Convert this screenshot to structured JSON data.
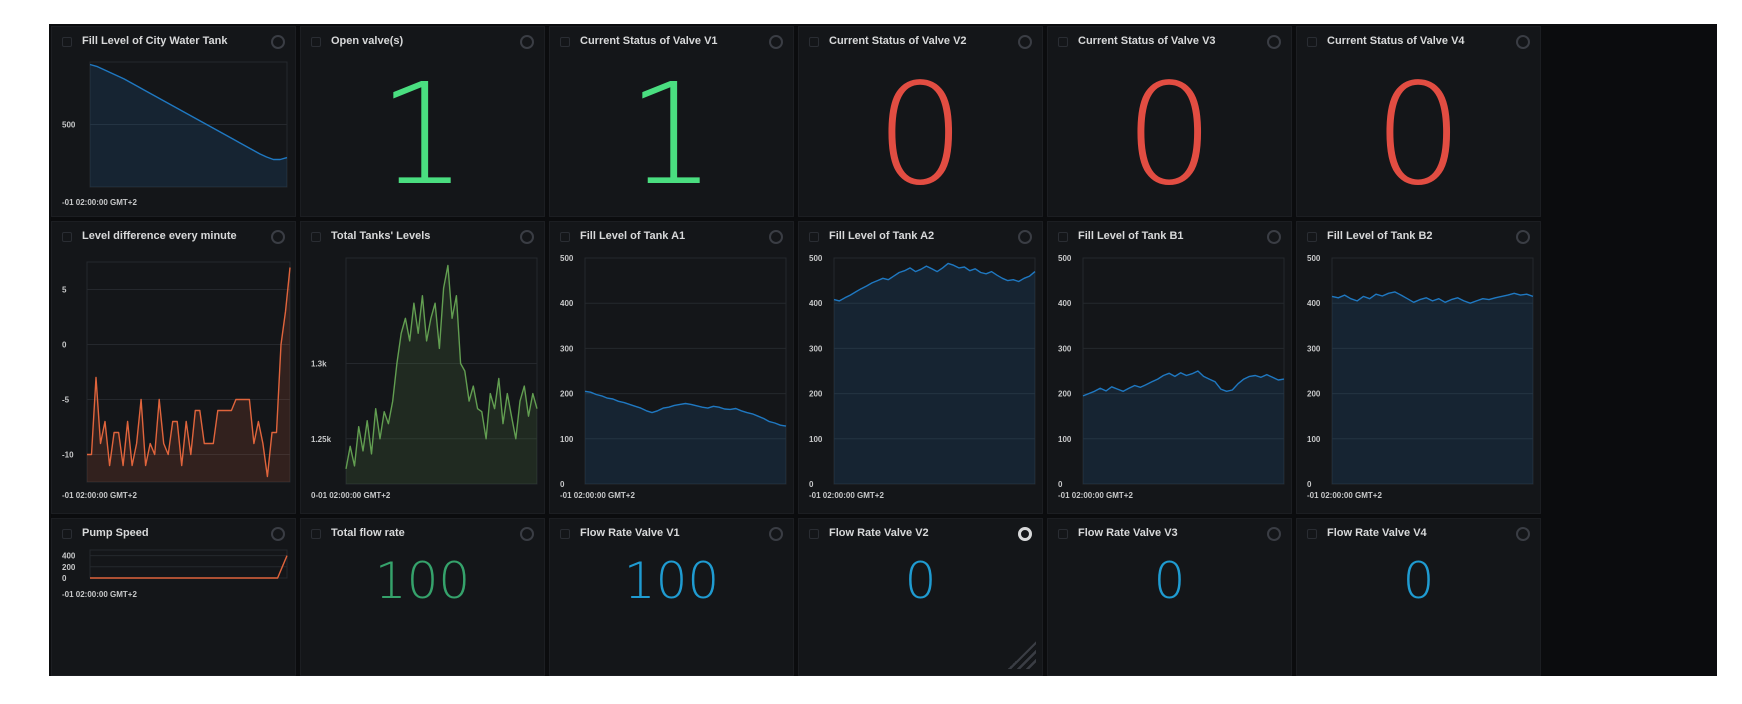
{
  "panels": {
    "city_tank": {
      "title": "Fill Level of City Water Tank",
      "y_tick": "500",
      "time": "-01 02:00:00 GMT+2",
      "color": "#1f78c1"
    },
    "open_valves": {
      "title": "Open valve(s)",
      "value": "1",
      "color": "#4ade80"
    },
    "valve_v1": {
      "title": "Current Status of Valve V1",
      "value": "1",
      "color": "#4ade80"
    },
    "valve_v2": {
      "title": "Current Status of Valve V2",
      "value": "0",
      "color": "#e24d42"
    },
    "valve_v3": {
      "title": "Current Status of Valve V3",
      "value": "0",
      "color": "#e24d42"
    },
    "valve_v4": {
      "title": "Current Status of Valve V4",
      "value": "0",
      "color": "#e24d42"
    },
    "level_diff": {
      "title": "Level difference every minute",
      "time": "-01 02:00:00 GMT+2",
      "color": "#e0643c"
    },
    "total_levels": {
      "title": "Total Tanks' Levels",
      "time": "0-01 02:00:00 GMT+2",
      "color": "#629e51"
    },
    "tank_a1": {
      "title": "Fill Level of Tank A1",
      "time": "-01 02:00:00 GMT+2",
      "color": "#1f78c1"
    },
    "tank_a2": {
      "title": "Fill Level of Tank A2",
      "time": "-01 02:00:00 GMT+2",
      "color": "#1f78c1"
    },
    "tank_b1": {
      "title": "Fill Level of Tank B1",
      "time": "-01 02:00:00 GMT+2",
      "color": "#1f78c1"
    },
    "tank_b2": {
      "title": "Fill Level of Tank B2",
      "time": "-01 02:00:00 GMT+2",
      "color": "#1f78c1"
    },
    "pump_speed": {
      "title": "Pump Speed",
      "time": "-01 02:00:00 GMT+2",
      "color": "#e0643c"
    },
    "total_flow": {
      "title": "Total flow rate",
      "value": "100",
      "color": "#35a26b"
    },
    "flow_v1": {
      "title": "Flow Rate Valve V1",
      "value": "100",
      "color": "#1f9bd1"
    },
    "flow_v2": {
      "title": "Flow Rate Valve V2",
      "value": "0",
      "color": "#1f9bd1"
    },
    "flow_v3": {
      "title": "Flow Rate Valve V3",
      "value": "0",
      "color": "#1f9bd1"
    },
    "flow_v4": {
      "title": "Flow Rate Valve V4",
      "value": "0",
      "color": "#1f9bd1"
    }
  },
  "chart_data": [
    {
      "id": "city_tank",
      "type": "area",
      "title": "Fill Level of City Water Tank",
      "yticks": [
        "500"
      ],
      "ylim": [
        0,
        1000
      ],
      "values": [
        980,
        965,
        940,
        915,
        890,
        865,
        835,
        805,
        775,
        745,
        715,
        685,
        655,
        625,
        595,
        565,
        535,
        505,
        475,
        445,
        415,
        385,
        355,
        325,
        295,
        265,
        240,
        220,
        220,
        235
      ]
    },
    {
      "id": "level_diff",
      "type": "area",
      "title": "Level difference every minute",
      "yticks": [
        "5",
        "0",
        "-5",
        "-10"
      ],
      "ylim": [
        -12.5,
        7.5
      ],
      "values": [
        -10,
        -10,
        -3,
        -9,
        -7,
        -11,
        -8,
        -8,
        -11,
        -7,
        -11,
        -9,
        -5,
        -11,
        -9,
        -10,
        -5,
        -9,
        -10,
        -7,
        -7,
        -11,
        -7,
        -10,
        -6,
        -6,
        -9,
        -9,
        -9,
        -6,
        -6,
        -6,
        -6,
        -5,
        -5,
        -5,
        -5,
        -9,
        -7,
        -9,
        -12,
        -8,
        -8,
        0,
        3,
        7
      ]
    },
    {
      "id": "total_levels",
      "type": "area",
      "title": "Total Tanks' Levels",
      "yticks": [
        "1.3k",
        "1.25k"
      ],
      "ylim": [
        1220,
        1370
      ],
      "values": [
        1230,
        1245,
        1232,
        1258,
        1242,
        1262,
        1240,
        1270,
        1250,
        1268,
        1260,
        1275,
        1300,
        1320,
        1330,
        1315,
        1340,
        1320,
        1345,
        1315,
        1330,
        1340,
        1310,
        1350,
        1365,
        1330,
        1345,
        1300,
        1295,
        1275,
        1285,
        1270,
        1268,
        1250,
        1280,
        1270,
        1290,
        1260,
        1280,
        1265,
        1250,
        1275,
        1285,
        1265,
        1280,
        1270
      ]
    },
    {
      "id": "tank_a1",
      "type": "area",
      "title": "Fill Level of Tank A1",
      "yticks": [
        "500",
        "400",
        "300",
        "200",
        "100",
        "0"
      ],
      "ylim": [
        0,
        500
      ],
      "values": [
        205,
        203,
        198,
        195,
        190,
        188,
        183,
        180,
        176,
        172,
        168,
        162,
        158,
        162,
        168,
        170,
        174,
        176,
        178,
        176,
        173,
        170,
        168,
        172,
        170,
        166,
        165,
        167,
        162,
        158,
        155,
        150,
        145,
        138,
        135,
        130,
        128
      ]
    },
    {
      "id": "tank_a2",
      "type": "area",
      "title": "Fill Level of Tank A2",
      "yticks": [
        "500",
        "400",
        "300",
        "200",
        "100",
        "0"
      ],
      "ylim": [
        0,
        500
      ],
      "values": [
        408,
        405,
        412,
        418,
        425,
        432,
        438,
        445,
        450,
        455,
        452,
        460,
        468,
        472,
        478,
        470,
        475,
        482,
        476,
        470,
        478,
        488,
        484,
        478,
        480,
        472,
        476,
        468,
        465,
        470,
        462,
        455,
        450,
        452,
        448,
        455,
        460,
        470
      ]
    },
    {
      "id": "tank_b1",
      "type": "area",
      "title": "Fill Level of Tank B1",
      "yticks": [
        "500",
        "400",
        "300",
        "200",
        "100",
        "0"
      ],
      "ylim": [
        0,
        500
      ],
      "values": [
        195,
        200,
        205,
        212,
        206,
        215,
        210,
        205,
        212,
        218,
        214,
        220,
        226,
        232,
        240,
        245,
        238,
        246,
        240,
        244,
        250,
        238,
        232,
        226,
        210,
        205,
        208,
        222,
        232,
        238,
        240,
        236,
        242,
        236,
        230,
        232
      ]
    },
    {
      "id": "tank_b2",
      "type": "area",
      "title": "Fill Level of Tank B2",
      "yticks": [
        "500",
        "400",
        "300",
        "200",
        "100",
        "0"
      ],
      "ylim": [
        0,
        500
      ],
      "values": [
        415,
        412,
        418,
        410,
        405,
        415,
        410,
        420,
        416,
        422,
        425,
        418,
        410,
        402,
        408,
        412,
        405,
        410,
        402,
        408,
        412,
        405,
        400,
        405,
        410,
        408,
        412,
        415,
        418,
        422,
        418,
        420,
        415
      ]
    },
    {
      "id": "pump_speed",
      "type": "line",
      "title": "Pump Speed",
      "yticks": [
        "400",
        "200",
        "0"
      ],
      "ylim": [
        0,
        500
      ],
      "values": [
        0,
        0,
        0,
        0,
        0,
        0,
        0,
        0,
        0,
        0,
        0,
        0,
        0,
        0,
        0,
        0,
        0,
        0,
        0,
        0,
        0,
        0,
        0,
        0,
        0,
        0,
        0,
        0,
        0,
        0,
        0,
        0,
        0,
        0,
        0,
        0,
        0,
        0,
        0,
        0,
        0,
        200,
        400
      ]
    }
  ]
}
